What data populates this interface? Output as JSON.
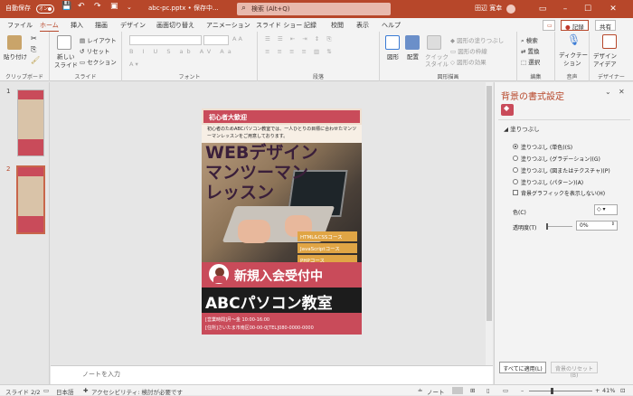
{
  "titlebar": {
    "autosave_label": "自動保存",
    "autosave_toggle": "オン",
    "filename": "abc-pc.pptx • 保存中...",
    "search_placeholder": "検索 (Alt+Q)",
    "user": "田辺 寛幸",
    "accent": "#b7472a"
  },
  "tabs": [
    "ファイル",
    "ホーム",
    "挿入",
    "描画",
    "デザイン",
    "画面切り替え",
    "アニメーション",
    "スライド ショー",
    "記録",
    "校閲",
    "表示",
    "ヘルプ"
  ],
  "active_tab": "ホーム",
  "tab_buttons": {
    "record": "記録",
    "share": "共有"
  },
  "ribbon": {
    "clipboard": {
      "paste": "貼り付け",
      "label": "クリップボード"
    },
    "slides": {
      "new_slide_1": "新しい",
      "new_slide_2": "スライド",
      "layout": "レイアウト",
      "reset": "リセット",
      "section": "セクション",
      "label": "スライド"
    },
    "font": {
      "label": "フォント"
    },
    "paragraph": {
      "label": "段落"
    },
    "drawing": {
      "shape": "図形",
      "arrange": "配置",
      "quick_style_1": "クイック",
      "quick_style_2": "スタイル",
      "fill": "図形の塗りつぶし",
      "outline": "図形の枠線",
      "effects": "図形の効果",
      "label": "図形描画"
    },
    "editing": {
      "find": "検索",
      "replace": "置換",
      "select": "選択",
      "label": "編集"
    },
    "voice": {
      "dictate": "ディクテー",
      "dictate2": "ション",
      "label": "音声"
    },
    "designer": {
      "line1": "デザイン",
      "line2": "アイデア",
      "label": "デザイナー"
    }
  },
  "thumbnails": [
    {
      "num": "1"
    },
    {
      "num": "2"
    }
  ],
  "slide": {
    "top_banner": "初心者大歓迎",
    "intro": "初心者のためABCパソコン教室では、一人ひとりの目標に合わせたマンツーマンレッスンをご用意しております。",
    "headline_1": "WEBデザイン",
    "headline_2": "マンツーマン",
    "headline_3": "レッスン",
    "courses": [
      "HTML&CSSコース",
      "JavaScriptコース",
      "PHPコース"
    ],
    "recruit": "新規入会受付中",
    "school": "ABCパソコン教室",
    "hours": "[営業時間]月～金 10:00-16:00",
    "address": "[住所]さいたま市南区00-00-0[TEL]080-0000-0000"
  },
  "notes_placeholder": "ノートを入力",
  "format_pane": {
    "title": "背景の書式設定",
    "section": "塗りつぶし",
    "options": [
      "塗りつぶし (単色)(S)",
      "塗りつぶし (グラデーション)(G)",
      "塗りつぶし (図またはテクスチャ)(P)",
      "塗りつぶし (パターン)(A)"
    ],
    "selected_option": 0,
    "hide_graphics": "背景グラフィックを表示しない(H)",
    "color_label": "色(C)",
    "transparency_label": "透明度(T)",
    "transparency_value": "0%",
    "apply_all": "すべてに適用(L)",
    "reset_bg": "背景のリセット(B)"
  },
  "status": {
    "slide": "スライド 2/2",
    "language": "日本語",
    "accessibility": "アクセシビリティ: 検討が必要です",
    "notes": "ノート",
    "zoom": "41%"
  }
}
